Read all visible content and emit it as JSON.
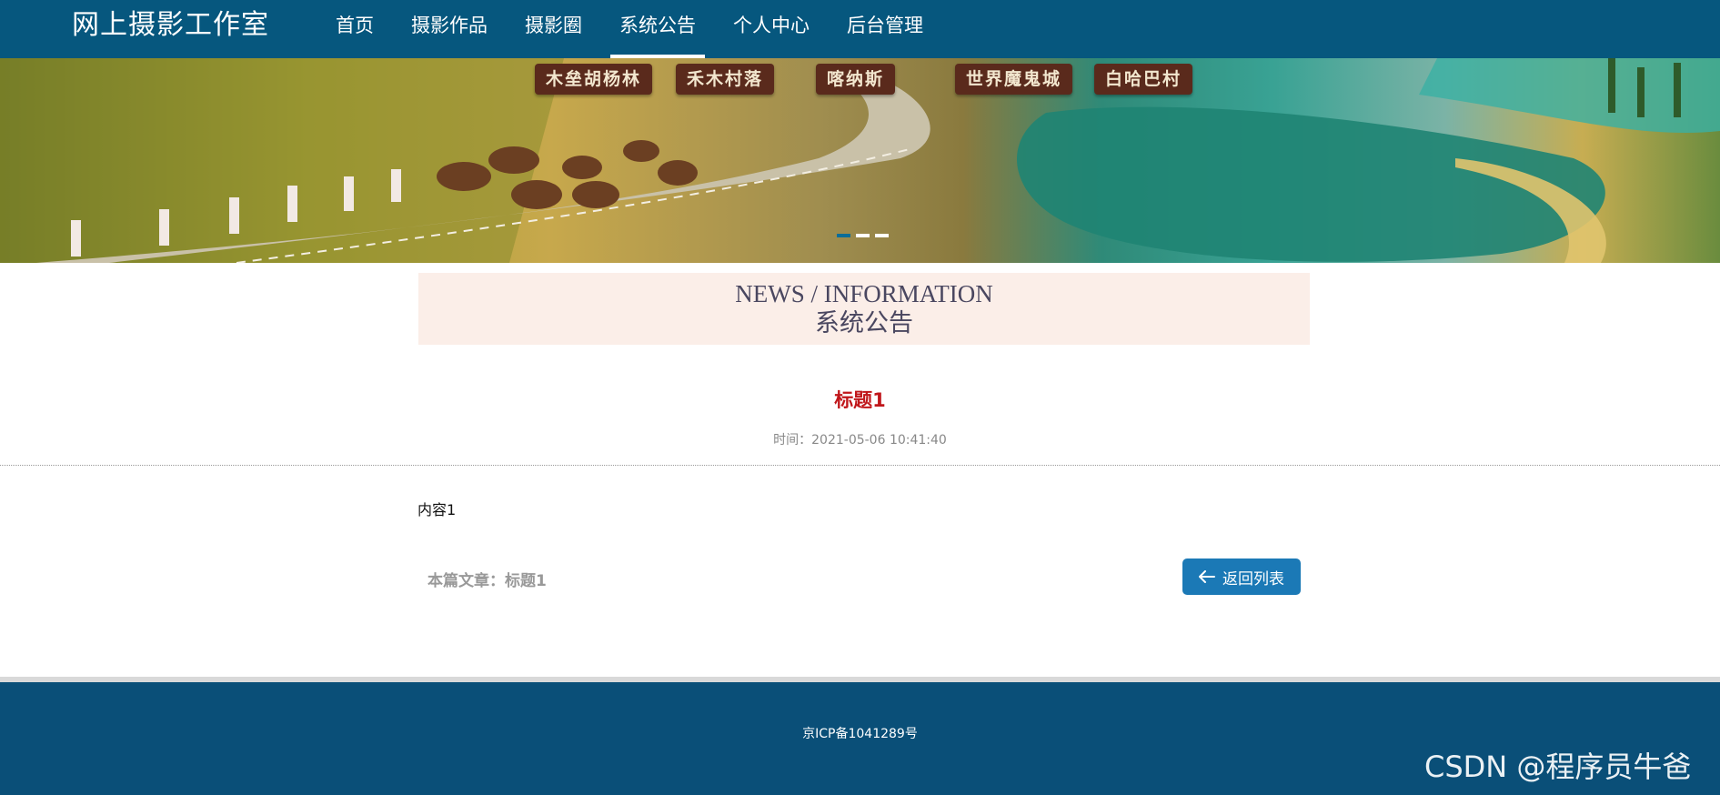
{
  "header": {
    "site_title": "网上摄影工作室",
    "nav": [
      {
        "label": "首页"
      },
      {
        "label": "摄影作品"
      },
      {
        "label": "摄影圈"
      },
      {
        "label": "系统公告",
        "active": true
      },
      {
        "label": "个人中心"
      },
      {
        "label": "后台管理"
      }
    ]
  },
  "banner": {
    "tags": [
      "木垒胡杨林",
      "禾木村落",
      "喀纳斯",
      "世界魔鬼城",
      "白哈巴村"
    ],
    "carousel_dots": 3,
    "active_dot": 0
  },
  "section": {
    "title_en": "NEWS / INFORMATION",
    "title_cn": "系统公告"
  },
  "article": {
    "title": "标题1",
    "time": "时间：2021-05-06 10:41:40",
    "content": "内容1",
    "this_article": "本篇文章：标题1",
    "back_button": "返回列表"
  },
  "footer": {
    "icp": "京ICP备1041289号"
  },
  "watermark": "CSDN @程序员牛爸",
  "colors": {
    "header_bg": "#06577e",
    "footer_bg": "#0a4f78",
    "title_red": "#c0161a",
    "button_blue": "#1b79b6",
    "section_bg": "#fbeee8"
  }
}
